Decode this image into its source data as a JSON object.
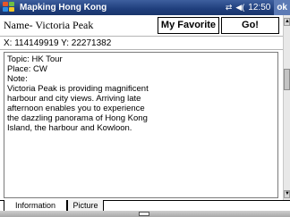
{
  "titlebar": {
    "app_title": "Mapking Hong Kong",
    "signal_icon": "connectivity-icon",
    "volume_icon": "speaker-icon",
    "time": "12:50",
    "ok_label": "ok"
  },
  "name_row": {
    "name_label": "Name- Victoria Peak",
    "favorite_button": "My Favorite",
    "go_button": "Go!"
  },
  "coords": "X: 114149919 Y: 22271382",
  "note": {
    "lines": [
      "Topic: HK Tour",
      "Place: CW",
      "Note:",
      "Victoria Peak is providing magnificent",
      "harbour and city views. Arriving late",
      "afternoon enables you to experience",
      "the dazzling panorama of Hong Kong",
      "Island, the harbour and Kowloon."
    ]
  },
  "tabs": [
    "Information",
    "Picture"
  ],
  "colors": {
    "titlebar": "#1f3e7c",
    "bottombar": "#a8a8a8"
  }
}
